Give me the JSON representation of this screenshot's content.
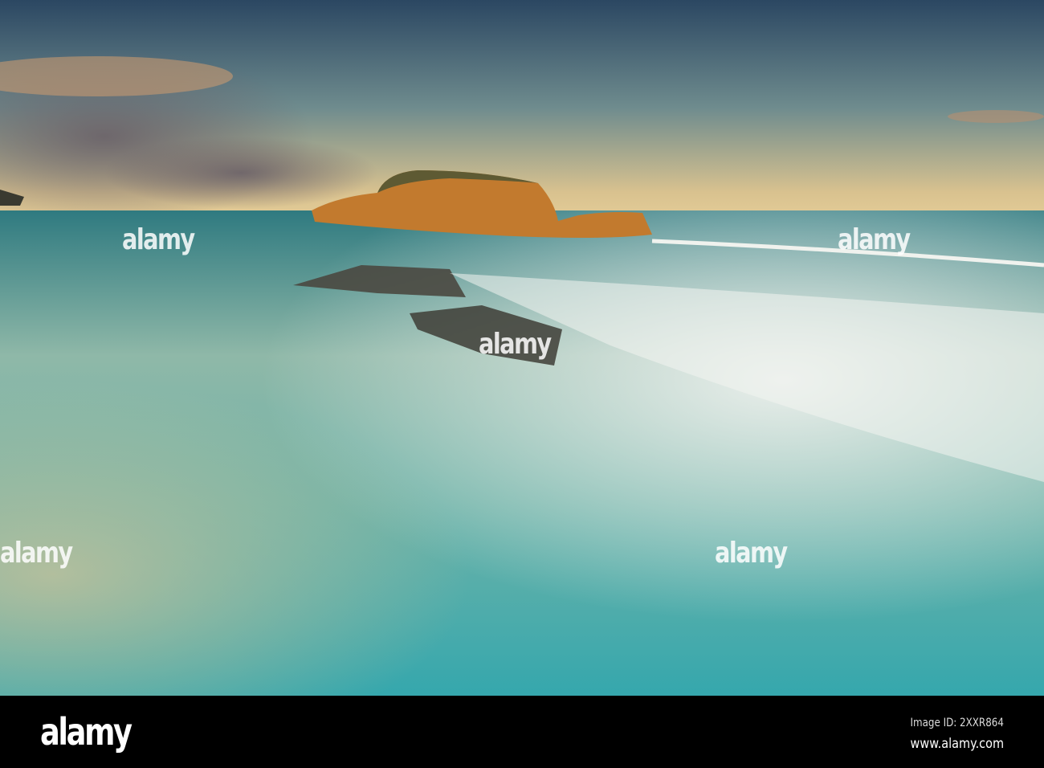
{
  "footer": {
    "brand": "alamy",
    "image_id": "Image ID: 2XXR864",
    "url": "www.alamy.com"
  },
  "watermark": {
    "text": "alamy"
  },
  "colors": {
    "sky_top": "#2f4a66",
    "sky_horizon": "#e7c98d",
    "sea": "#3d8f93",
    "foam": "#e8ece8",
    "rock": "#c27a2e"
  }
}
